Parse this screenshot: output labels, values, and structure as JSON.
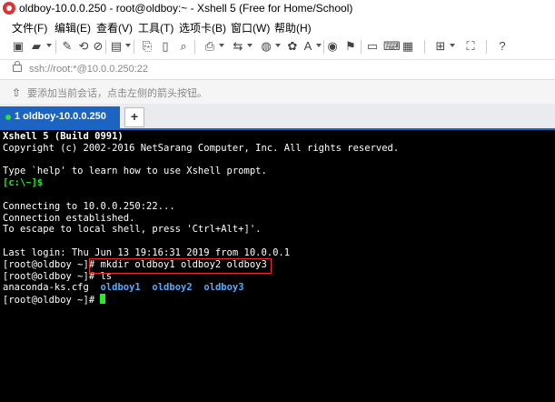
{
  "window": {
    "title": "oldboy-10.0.0.250 - root@oldboy:~ - Xshell 5 (Free for Home/School)"
  },
  "menu": [
    "文件(F)",
    "编辑(E)",
    "查看(V)",
    "工具(T)",
    "选项卡(B)",
    "窗口(W)",
    "帮助(H)"
  ],
  "toolbar": {
    "icons": [
      "new-session-icon",
      "open-folder-icon",
      "properties-icon",
      "reconnect-icon",
      "disconnect-icon",
      "new-terminal-icon",
      "copy-icon",
      "paste-icon",
      "find-icon",
      "print-icon",
      "transfer-icon",
      "globe-icon",
      "color-scheme-icon",
      "font-icon",
      "xftp-icon",
      "tunnel-icon",
      "compose-icon",
      "keyboard-icon",
      "add-pane-icon",
      "fullscreen-icon",
      "help-icon"
    ]
  },
  "address": {
    "text": "ssh://root:*@10.0.0.250:22"
  },
  "hint": {
    "text": "要添加当前会话，点击左侧的箭头按钮。"
  },
  "tabs": [
    {
      "label": "1 oldboy-10.0.0.250",
      "active": true,
      "status_color": "#33dd33"
    }
  ],
  "tab_add": "+",
  "terminal": {
    "banner_title": "Xshell 5 (Build 0991)",
    "copyright": "Copyright (c) 2002-2016 NetSarang Computer, Inc. All rights reserved.",
    "help": "Type `help' to learn how to use Xshell prompt.",
    "local_prompt": "[c:\\~]$",
    "connecting": "Connecting to 10.0.0.250:22...",
    "established": "Connection established.",
    "escape": "To escape to local shell, press 'Ctrl+Alt+]'.",
    "last_login": "Last login: Thu Jun 13 19:16:31 2019 from 10.0.0.1",
    "prompt": "[root@oldboy ~]# ",
    "cmd1": "mkdir oldboy1 oldboy2 oldboy3",
    "cmd2": "ls",
    "ls_file": "anaconda-ks.cfg",
    "ls_dirs": [
      "oldboy1",
      "oldboy2",
      "oldboy3"
    ]
  }
}
